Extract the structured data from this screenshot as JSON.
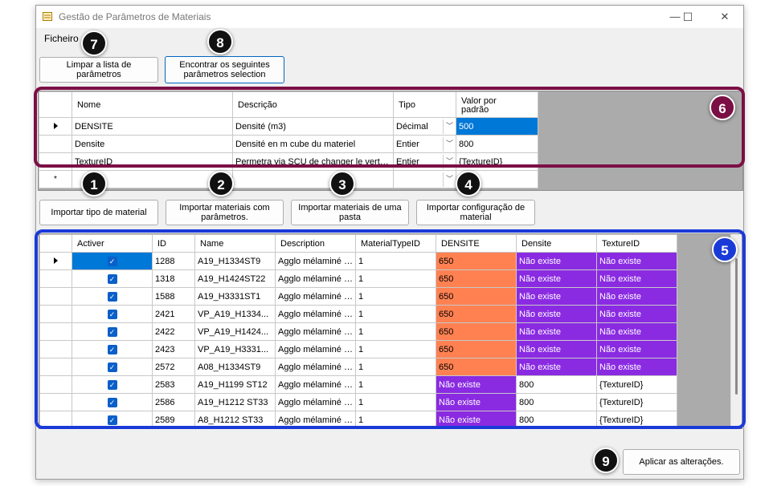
{
  "window": {
    "title": "Gestão de Parâmetros de Materiais",
    "minimize": "—",
    "maximize": "☐",
    "close": "✕"
  },
  "menu": {
    "file": "Ficheiro"
  },
  "top_buttons": {
    "clear": "Limpar a lista de parâmetros",
    "find_line1": "Encontrar os seguintes",
    "find_line2": "parâmetros selection"
  },
  "params_table": {
    "headers": [
      "Nome",
      "Descrição",
      "Tipo",
      "Valor por",
      "padrão"
    ],
    "rows": [
      {
        "name": "DENSITE",
        "desc": "Densité (m3)",
        "type": "Décimal",
        "value": "500"
      },
      {
        "name": "Densite",
        "desc": "Densité en m cube du materiel",
        "type": "Entier",
        "value": "800"
      },
      {
        "name": "TextureID",
        "desc": "Permetra via SCU de changer le vert d...",
        "type": "Entier",
        "value": "{TextureID}"
      }
    ],
    "new_row_marker": "*"
  },
  "middle_buttons": {
    "b1": "Importar tipo de material",
    "b2_line1": "Importar materiais com",
    "b2_line2": "parâmetros.",
    "b3_line1": "Importar materiais de uma",
    "b3_line2": "pasta",
    "b4_line1": "Importar configuração de",
    "b4_line2": "material"
  },
  "materials_table": {
    "headers": [
      "Activer",
      "ID",
      "Name",
      "Description",
      "MaterialTypeID",
      "DENSITE",
      "Densite",
      "TextureID"
    ],
    "rows": [
      {
        "id": "1288",
        "name": "A19_H1334ST9",
        "desc": "Agglo mélaminé 1...",
        "type": "1",
        "densite_up": "650",
        "densite": "Não existe",
        "texture": "Não existe"
      },
      {
        "id": "1318",
        "name": "A19_H1424ST22",
        "desc": "Agglo mélaminé 1...",
        "type": "1",
        "densite_up": "650",
        "densite": "Não existe",
        "texture": "Não existe"
      },
      {
        "id": "1588",
        "name": "A19_H3331ST1",
        "desc": "Agglo mélaminé 1...",
        "type": "1",
        "densite_up": "650",
        "densite": "Não existe",
        "texture": "Não existe"
      },
      {
        "id": "2421",
        "name": "VP_A19_H1334...",
        "desc": "Agglo mélaminé 1...",
        "type": "1",
        "densite_up": "650",
        "densite": "Não existe",
        "texture": "Não existe"
      },
      {
        "id": "2422",
        "name": "VP_A19_H1424...",
        "desc": "Agglo mélaminé 1...",
        "type": "1",
        "densite_up": "650",
        "densite": "Não existe",
        "texture": "Não existe"
      },
      {
        "id": "2423",
        "name": "VP_A19_H3331...",
        "desc": "Agglo mélaminé 1...",
        "type": "1",
        "densite_up": "650",
        "densite": "Não existe",
        "texture": "Não existe"
      },
      {
        "id": "2572",
        "name": "A08_H1334ST9",
        "desc": "Agglo mélaminé 8...",
        "type": "1",
        "densite_up": "650",
        "densite": "Não existe",
        "texture": "Não existe"
      },
      {
        "id": "2583",
        "name": "A19_H1199 ST12",
        "desc": "Agglo mélaminé 1...",
        "type": "1",
        "densite_up": "Não existe",
        "densite": "800",
        "texture": "{TextureID}"
      },
      {
        "id": "2586",
        "name": "A19_H1212 ST33",
        "desc": "Agglo mélaminé 1...",
        "type": "1",
        "densite_up": "Não existe",
        "densite": "800",
        "texture": "{TextureID}"
      },
      {
        "id": "2589",
        "name": "A8_H1212 ST33",
        "desc": "Agglo mélaminé 8...",
        "type": "1",
        "densite_up": "Não existe",
        "densite": "800",
        "texture": "{TextureID}"
      }
    ]
  },
  "apply_button": "Aplicar as alterações.",
  "badges": [
    "1",
    "2",
    "3",
    "4",
    "5",
    "6",
    "7",
    "8",
    "9"
  ],
  "colors": {
    "orange": "#ff8152",
    "purple": "#8a2be2",
    "selection": "#0078d7",
    "frame_maroon": "#7b0f45",
    "frame_blue": "#1a3ad8"
  }
}
